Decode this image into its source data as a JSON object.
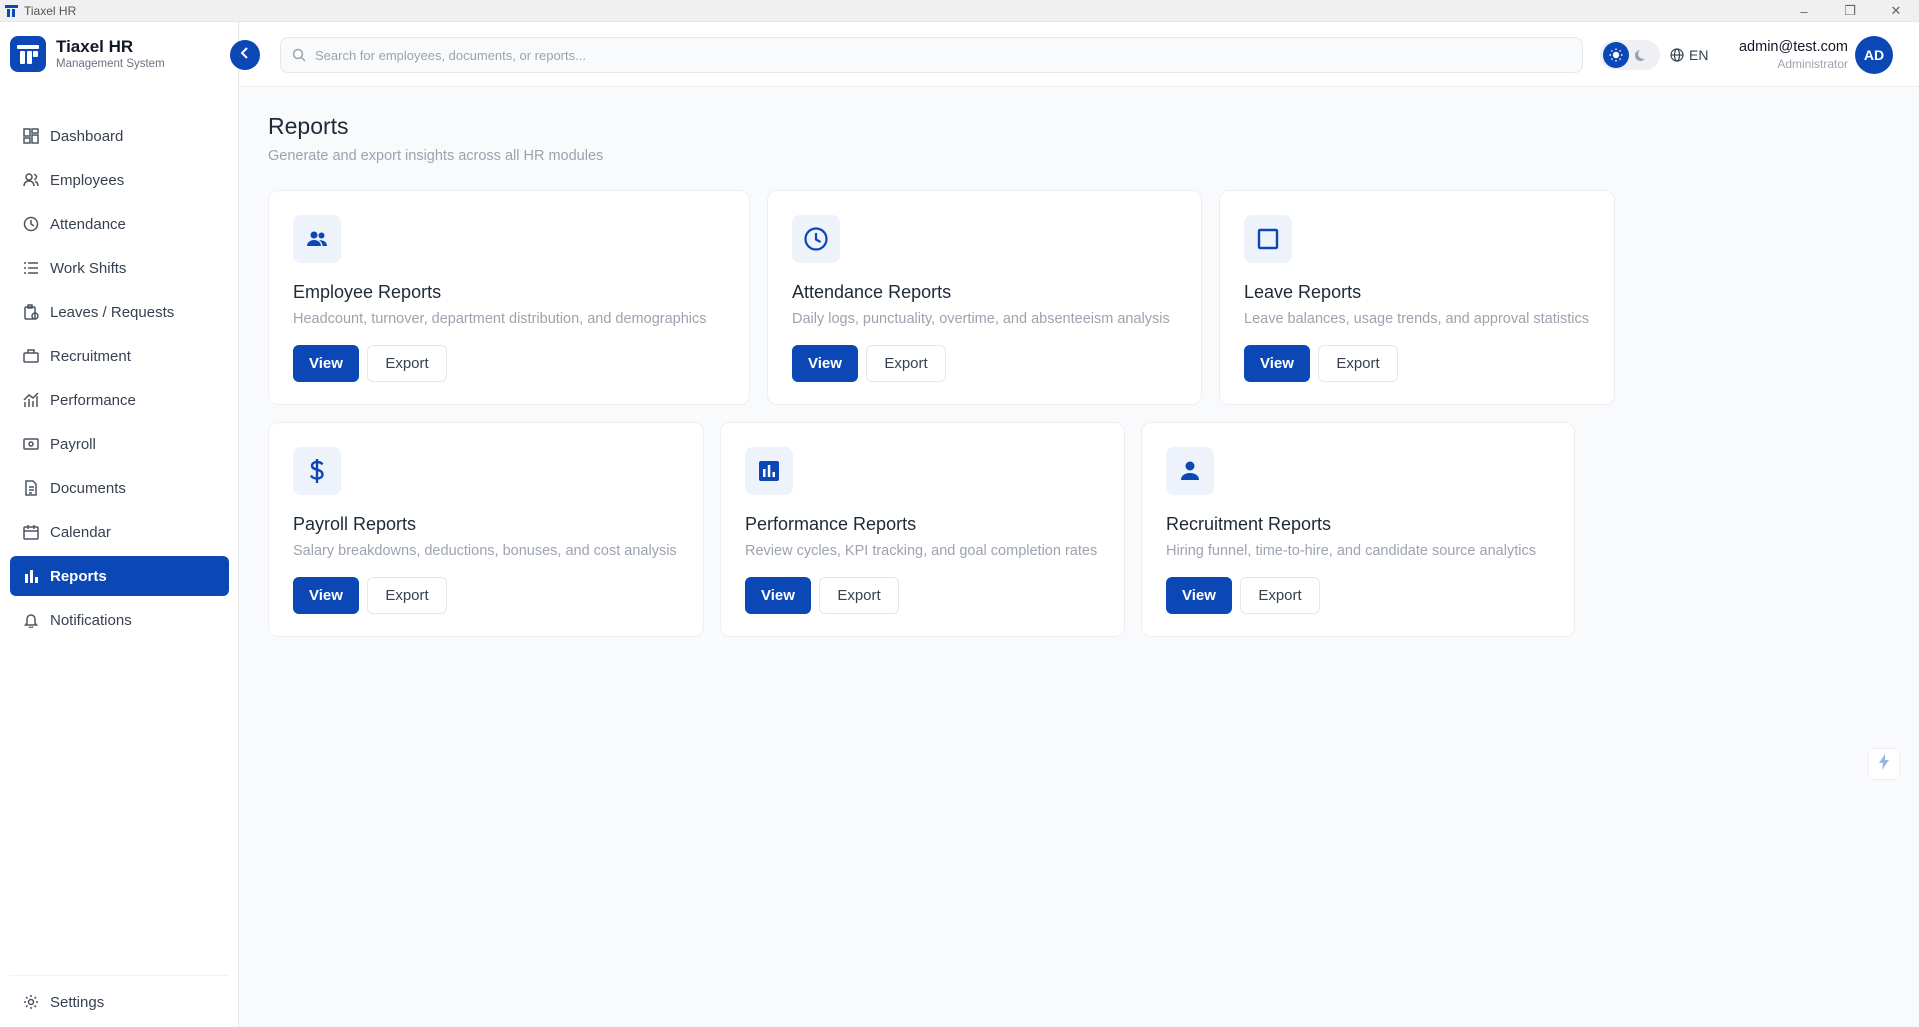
{
  "window": {
    "title": "Tiaxel HR",
    "minimize": "–",
    "restore": "❐",
    "close": "✕"
  },
  "brand": {
    "name": "Tiaxel HR",
    "subtitle": "Management System"
  },
  "sidebar": {
    "items": [
      {
        "label": "Dashboard",
        "icon": "dashboard-icon"
      },
      {
        "label": "Employees",
        "icon": "users-icon"
      },
      {
        "label": "Attendance",
        "icon": "clock-icon"
      },
      {
        "label": "Work Shifts",
        "icon": "list-icon"
      },
      {
        "label": "Leaves / Requests",
        "icon": "clipboard-icon"
      },
      {
        "label": "Recruitment",
        "icon": "briefcase-icon"
      },
      {
        "label": "Performance",
        "icon": "chart-line-icon"
      },
      {
        "label": "Payroll",
        "icon": "money-icon"
      },
      {
        "label": "Documents",
        "icon": "document-icon"
      },
      {
        "label": "Calendar",
        "icon": "calendar-icon"
      },
      {
        "label": "Reports",
        "icon": "bar-chart-icon",
        "active": true
      },
      {
        "label": "Notifications",
        "icon": "bell-icon"
      }
    ],
    "settings": {
      "label": "Settings",
      "icon": "gear-icon"
    }
  },
  "header": {
    "search_placeholder": "Search for employees, documents, or reports...",
    "language": "EN",
    "user": {
      "email": "admin@test.com",
      "role": "Administrator",
      "initials": "AD"
    }
  },
  "page": {
    "title": "Reports",
    "subtitle": "Generate and export insights across all HR modules"
  },
  "cards": [
    {
      "title": "Employee Reports",
      "description": "Headcount, turnover, department distribution, and demographics",
      "icon": "people-icon",
      "view": "View",
      "export": "Export"
    },
    {
      "title": "Attendance Reports",
      "description": "Daily logs, punctuality, overtime, and absenteeism analysis",
      "icon": "clock-icon",
      "view": "View",
      "export": "Export"
    },
    {
      "title": "Leave Reports",
      "description": "Leave balances, usage trends, and approval statistics",
      "icon": "square-icon",
      "view": "View",
      "export": "Export"
    },
    {
      "title": "Payroll Reports",
      "description": "Salary breakdowns, deductions, bonuses, and cost analysis",
      "icon": "dollar-icon",
      "view": "View",
      "export": "Export"
    },
    {
      "title": "Performance Reports",
      "description": "Review cycles, KPI tracking, and goal completion rates",
      "icon": "bar-chart-icon",
      "view": "View",
      "export": "Export"
    },
    {
      "title": "Recruitment Reports",
      "description": "Hiring funnel, time-to-hire, and candidate source analytics",
      "icon": "person-icon",
      "view": "View",
      "export": "Export"
    }
  ],
  "colors": {
    "primary": "#0b47b5",
    "icon_bg": "#eef2fb",
    "muted_text": "#9ca3af"
  }
}
